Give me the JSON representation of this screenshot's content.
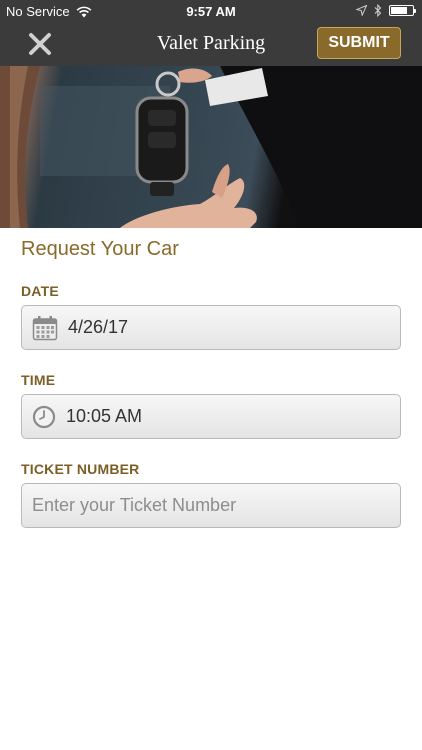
{
  "status_bar": {
    "carrier": "No Service",
    "time": "9:57 AM",
    "battery_level": 0.75
  },
  "nav": {
    "title": "Valet Parking",
    "close_icon": "close-x-icon",
    "submit_label": "SUBMIT"
  },
  "hero": {
    "icon": "hand-holding-car-key-photo"
  },
  "form": {
    "heading": "Request Your Car",
    "date_label": "DATE",
    "date_value": "4/26/17",
    "date_icon": "calendar-icon",
    "time_label": "TIME",
    "time_value": "10:05 AM",
    "time_icon": "clock-icon",
    "ticket_label": "TICKET NUMBER",
    "ticket_placeholder": "Enter your Ticket Number",
    "ticket_value": ""
  },
  "colors": {
    "accent": "#8a6a2a",
    "navbar": "#3b3b3b"
  }
}
